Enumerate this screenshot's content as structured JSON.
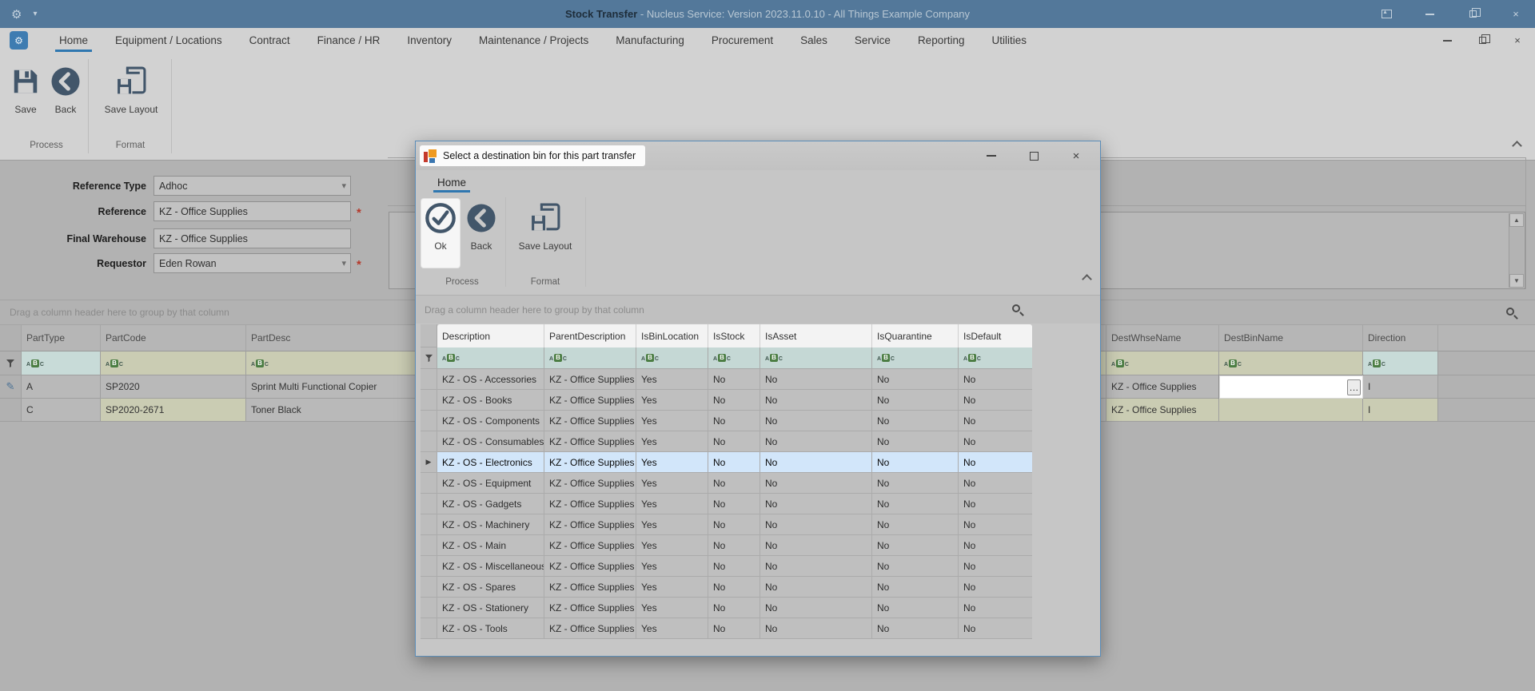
{
  "titlebar": {
    "title_primary": "Stock Transfer",
    "title_secondary": " - Nucleus Service: Version 2023.11.0.10 - All Things Example Company"
  },
  "ribbon": {
    "tabs": [
      {
        "label": "Home",
        "active": true
      },
      {
        "label": "Equipment / Locations",
        "active": false
      },
      {
        "label": "Contract",
        "active": false
      },
      {
        "label": "Finance / HR",
        "active": false
      },
      {
        "label": "Inventory",
        "active": false
      },
      {
        "label": "Maintenance / Projects",
        "active": false
      },
      {
        "label": "Manufacturing",
        "active": false
      },
      {
        "label": "Procurement",
        "active": false
      },
      {
        "label": "Sales",
        "active": false
      },
      {
        "label": "Service",
        "active": false
      },
      {
        "label": "Reporting",
        "active": false
      },
      {
        "label": "Utilities",
        "active": false
      }
    ],
    "buttons": {
      "save": "Save",
      "back": "Back",
      "save_layout": "Save Layout"
    },
    "groups": [
      "Process",
      "Format"
    ]
  },
  "form": {
    "fields": [
      {
        "label": "Reference Type",
        "value": "Adhoc"
      },
      {
        "label": "Reference",
        "value": "KZ - Office Supplies"
      },
      {
        "label": "Final Warehouse",
        "value": "KZ - Office Supplies"
      },
      {
        "label": "Requestor",
        "value": "Eden Rowan"
      }
    ]
  },
  "main_grid": {
    "group_hint": "Drag a column header here to group by that column",
    "columns": {
      "part_type": "PartType",
      "part_code": "PartCode",
      "part_desc": "PartDesc",
      "dest_whse": "DestWhseName",
      "dest_bin": "DestBinName",
      "direction": "Direction"
    },
    "rows": [
      {
        "part_type": "A",
        "part_code": "SP2020",
        "part_desc": "Sprint Multi Functional Copier",
        "dest_whse": "KZ - Office Supplies",
        "dest_bin": "",
        "direction": "I"
      },
      {
        "part_type": "C",
        "part_code": "SP2020-2671",
        "part_desc": "Toner Black",
        "dest_whse": "KZ - Office Supplies",
        "dest_bin": "",
        "direction": "I"
      }
    ]
  },
  "dialog": {
    "title": "Select a destination bin for this part transfer",
    "tab": "Home",
    "buttons": {
      "ok": "Ok",
      "back": "Back",
      "save_layout": "Save Layout"
    },
    "groups": [
      "Process",
      "Format"
    ],
    "grid": {
      "group_hint": "Drag a column header here to group by that column",
      "columns": [
        "Description",
        "ParentDescription",
        "IsBinLocation",
        "IsStock",
        "IsAsset",
        "IsQuarantine",
        "IsDefault"
      ],
      "rows": [
        {
          "cells": [
            "KZ - OS - Accessories",
            "KZ - Office Supplies",
            "Yes",
            "No",
            "No",
            "No",
            "No"
          ],
          "selected": false
        },
        {
          "cells": [
            "KZ - OS - Books",
            "KZ - Office Supplies",
            "Yes",
            "No",
            "No",
            "No",
            "No"
          ],
          "selected": false
        },
        {
          "cells": [
            "KZ - OS - Components",
            "KZ - Office Supplies",
            "Yes",
            "No",
            "No",
            "No",
            "No"
          ],
          "selected": false
        },
        {
          "cells": [
            "KZ - OS - Consumables",
            "KZ - Office Supplies",
            "Yes",
            "No",
            "No",
            "No",
            "No"
          ],
          "selected": false
        },
        {
          "cells": [
            "KZ - OS - Electronics",
            "KZ - Office Supplies",
            "Yes",
            "No",
            "No",
            "No",
            "No"
          ],
          "selected": true
        },
        {
          "cells": [
            "KZ - OS - Equipment",
            "KZ - Office Supplies",
            "Yes",
            "No",
            "No",
            "No",
            "No"
          ],
          "selected": false
        },
        {
          "cells": [
            "KZ - OS - Gadgets",
            "KZ - Office Supplies",
            "Yes",
            "No",
            "No",
            "No",
            "No"
          ],
          "selected": false
        },
        {
          "cells": [
            "KZ - OS - Machinery",
            "KZ - Office Supplies",
            "Yes",
            "No",
            "No",
            "No",
            "No"
          ],
          "selected": false
        },
        {
          "cells": [
            "KZ - OS - Main",
            "KZ - Office Supplies",
            "Yes",
            "No",
            "No",
            "No",
            "No"
          ],
          "selected": false
        },
        {
          "cells": [
            "KZ - OS - Miscellaneous",
            "KZ - Office Supplies",
            "Yes",
            "No",
            "No",
            "No",
            "No"
          ],
          "selected": false
        },
        {
          "cells": [
            "KZ - OS - Spares",
            "KZ - Office Supplies",
            "Yes",
            "No",
            "No",
            "No",
            "No"
          ],
          "selected": false
        },
        {
          "cells": [
            "KZ - OS - Stationery",
            "KZ - Office Supplies",
            "Yes",
            "No",
            "No",
            "No",
            "No"
          ],
          "selected": false
        },
        {
          "cells": [
            "KZ - OS - Tools",
            "KZ - Office Supplies",
            "Yes",
            "No",
            "No",
            "No",
            "No"
          ],
          "selected": false
        }
      ]
    }
  },
  "icons": {
    "gear": "⚙",
    "dropdown_arrow": "▾",
    "ellipsis": "…",
    "required_asterisk": "*",
    "scroll_up": "▲",
    "scroll_down": "▼",
    "focus_arrow": "▶",
    "pencil": "✎",
    "minimize": "–",
    "close": "×"
  }
}
